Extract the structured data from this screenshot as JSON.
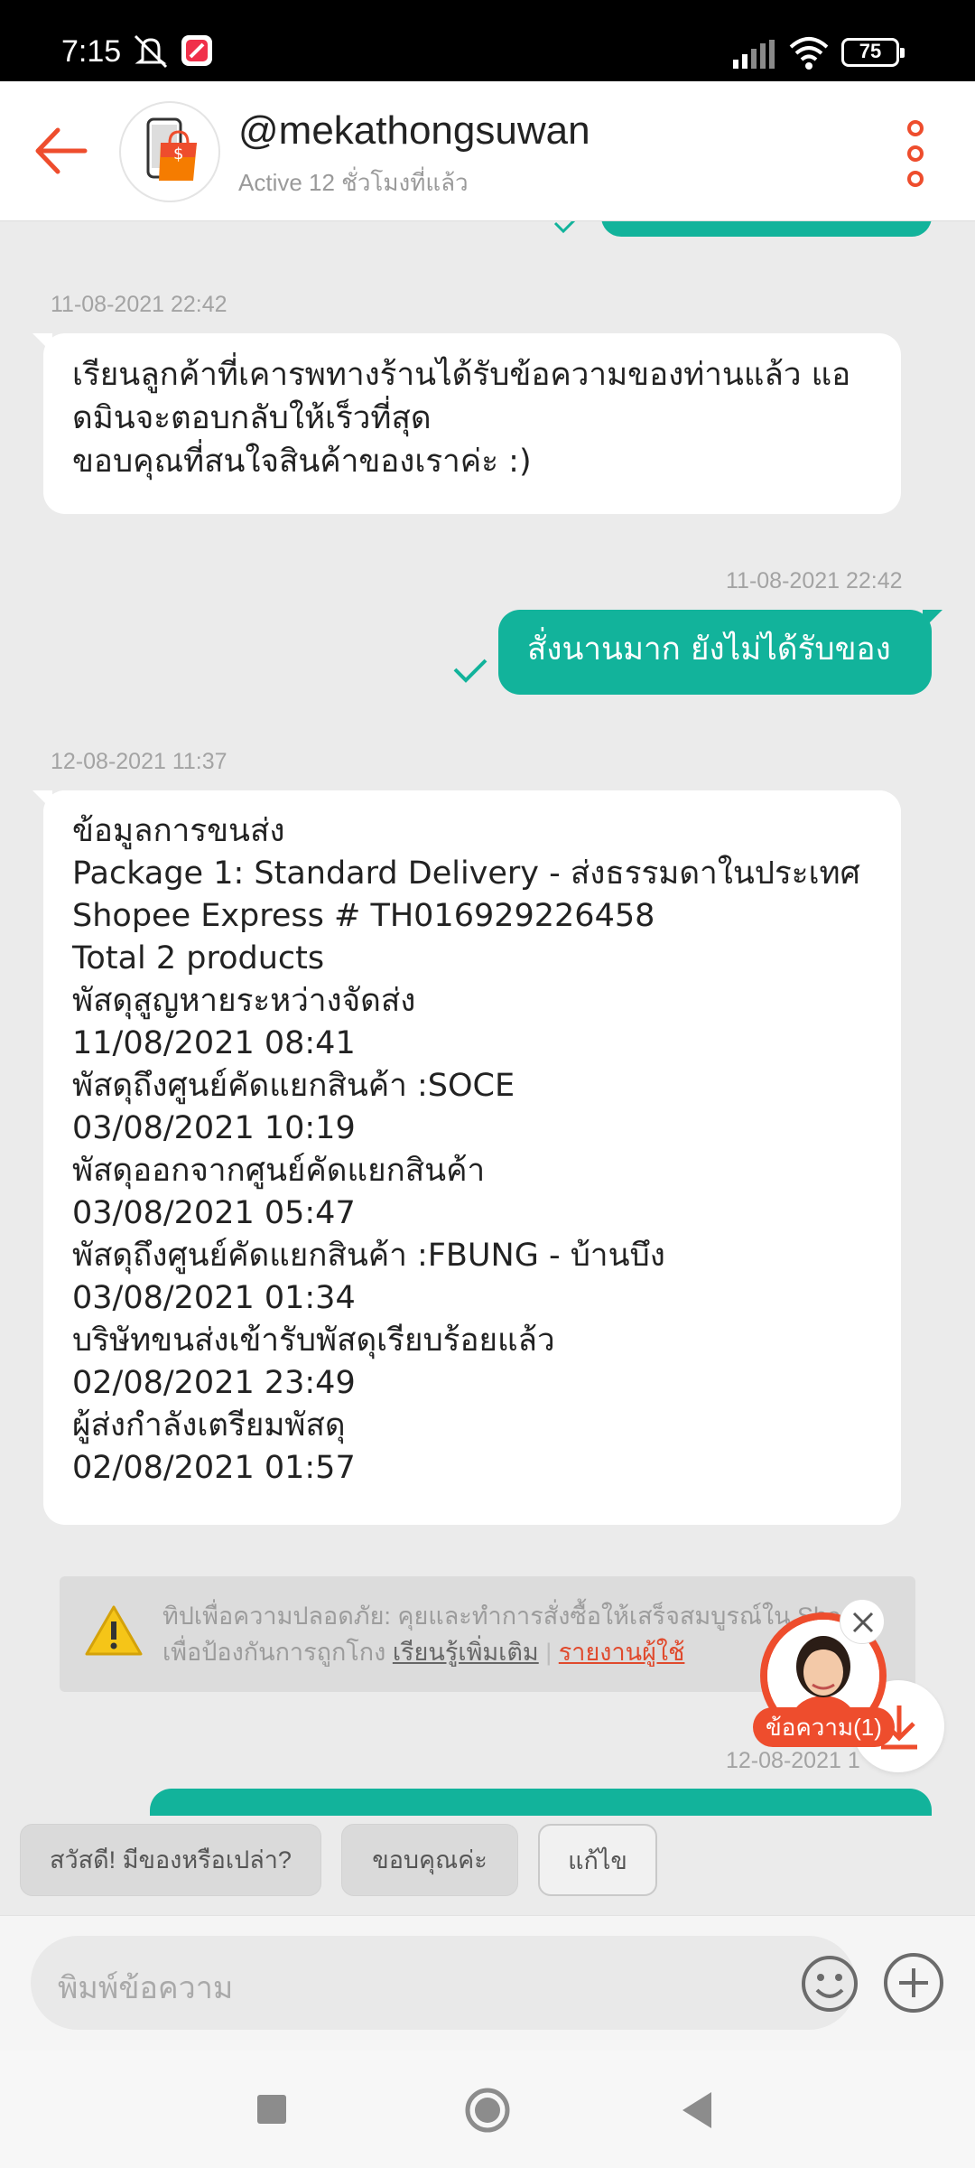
{
  "status_bar": {
    "time": "7:15",
    "battery": "75",
    "icons": [
      "mute-icon",
      "news-app-icon",
      "signal-icon",
      "wifi-icon",
      "battery-icon"
    ]
  },
  "header": {
    "shop_name": "@mekathongsuwan",
    "active_status": "Active 12 ชั่วโมงที่แล้ว",
    "accent_color": "#ee4d2d"
  },
  "messages": [
    {
      "timestamp": "11-08-2021 22:42",
      "direction": "incoming",
      "lines": [
        "เรียนลูกค้าที่เคารพทางร้านได้รับข้อความของท่านแล้ว แอ",
        "ดมินจะตอบกลับให้เร็วที่สุด",
        "ขอบคุณที่สนใจสินค้าของเราค่ะ :)"
      ]
    },
    {
      "timestamp": "11-08-2021 22:42",
      "direction": "outgoing",
      "lines": [
        "สั่งนานมาก ยังไม่ได้รับของ"
      ]
    },
    {
      "timestamp": "12-08-2021 11:37",
      "direction": "incoming",
      "lines": [
        "ข้อมูลการขนส่ง",
        "Package 1: Standard Delivery - ส่งธรรมดาในประเทศ",
        "Shopee Express # TH016929226458",
        "Total 2 products",
        "พัสดุสูญหายระหว่างจัดส่ง",
        "11/08/2021 08:41",
        "พัสดุถึงศูนย์คัดแยกสินค้า :SOCE",
        "03/08/2021 10:19",
        "พัสดุออกจากศูนย์คัดแยกสินค้า",
        "03/08/2021 05:47",
        "พัสดุถึงศูนย์คัดแยกสินค้า :FBUNG - บ้านบึง",
        "03/08/2021 01:34",
        "บริษัทขนส่งเข้ารับพัสดุเรียบร้อยแล้ว",
        "02/08/2021 23:49",
        "ผู้ส่งกำลังเตรียมพัสดุ",
        "02/08/2021 01:57"
      ]
    },
    {
      "timestamp": "12-08-2021 1",
      "direction": "outgoing",
      "lines": []
    }
  ],
  "tip": {
    "line1": "ทิปเพื่อความปลอดภัย: คุยและทำการสั่งซื้อให้เสร็จสมบูรณ์ใน Shopee",
    "line2_prefix": "เพื่อป้องกันการถูกโกง ",
    "learn_more": "เรียนรู้เพิ่มเติม",
    "separator": "|",
    "report": "รายงานผู้ใช้"
  },
  "agent": {
    "label": "ข้อความ(1)"
  },
  "quick_replies": [
    "สวัสดี! มีของหรือเปล่า?",
    "ขอบคุณค่ะ",
    "แก้ไข"
  ],
  "composer": {
    "placeholder": "พิมพ์ข้อความ"
  },
  "colors": {
    "accent": "#ee4d2d",
    "outgoing_bubble": "#12b39b",
    "background": "#ebebeb"
  }
}
